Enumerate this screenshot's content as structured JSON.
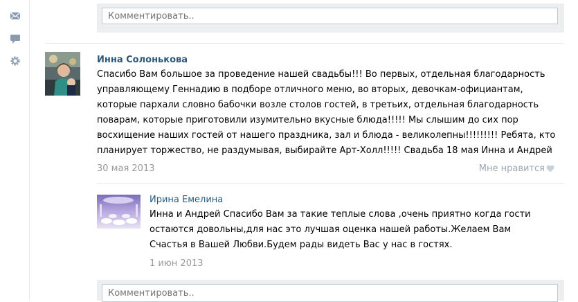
{
  "sidebar": {
    "icons": [
      "mail-icon",
      "chat-bubble-icon",
      "gear-icon"
    ]
  },
  "top_comment_box": {
    "placeholder": "Комментировать.."
  },
  "comments": [
    {
      "author": "Инна Солонькова",
      "text": "Спасибо Вам большое за проведение нашей свадьбы!!! Во первых, отдельная благодарность управляющему Геннадию в подборе отличного меню, во вторых, девочкам-официантам, которые пархали словно бабочки возле столов гостей, в третьих, отдельная благодарность поварам, которые приготовили изумительно вкусные блюда!!!!! Мы слышим до сих пор восхищение наших гостей от нашего праздника, зал и блюда - великолепны!!!!!!!!! Ребята, кто планирует торжество, не раздумывая, выбирайте Арт-Холл!!!!! Свадьба 18 мая Инна и Андрей",
      "date": "30 мая 2013",
      "like_label": "Мне нравится"
    }
  ],
  "reply": {
    "author": "Ирина Емелина",
    "text": "Инна и Андрей Спасибо Вам за такие теплые слова ,очень приятно когда гости остаются довольны,для нас это лучшая оценка нашей работы.Желаем Вам Счастья в Вашей Любви.Будем рады видеть Вас у нас в гостях.",
    "date": "1 июн 2013"
  },
  "bottom_comment_box": {
    "placeholder": "Комментировать.."
  },
  "colors": {
    "link": "#2b587a",
    "muted": "#999999",
    "box_bg": "#edeef0",
    "border": "#c0cad5"
  }
}
